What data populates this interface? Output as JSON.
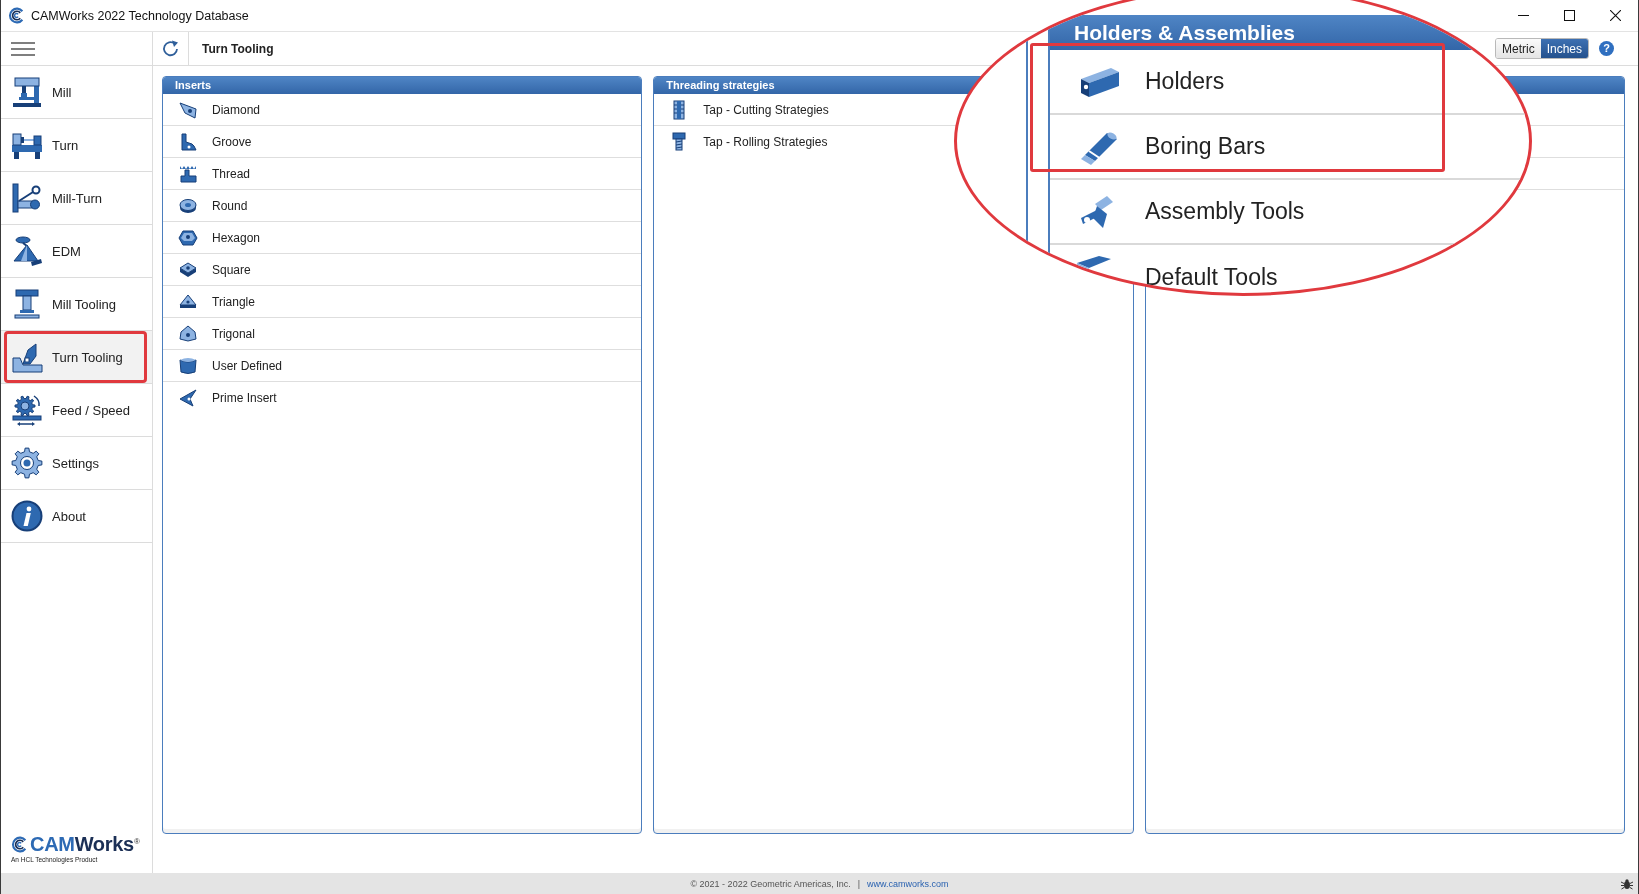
{
  "window": {
    "title": "CAMWorks 2022 Technology Database"
  },
  "toolbar": {
    "title": "Turn Tooling",
    "units": [
      {
        "label": "Metric",
        "selected": false
      },
      {
        "label": "Inches",
        "selected": true
      }
    ],
    "help": "?"
  },
  "sidebar": {
    "items": [
      {
        "label": "Mill",
        "selected": false,
        "highlighted": false
      },
      {
        "label": "Turn",
        "selected": false,
        "highlighted": false
      },
      {
        "label": "Mill-Turn",
        "selected": false,
        "highlighted": false
      },
      {
        "label": "EDM",
        "selected": false,
        "highlighted": false
      },
      {
        "label": "Mill Tooling",
        "selected": false,
        "highlighted": false
      },
      {
        "label": "Turn Tooling",
        "selected": true,
        "highlighted": true
      },
      {
        "label": "Feed / Speed",
        "selected": false,
        "highlighted": false
      },
      {
        "label": "Settings",
        "selected": false,
        "highlighted": false
      },
      {
        "label": "About",
        "selected": false,
        "highlighted": false
      }
    ]
  },
  "panels": [
    {
      "title": "Inserts",
      "items": [
        {
          "label": "Diamond"
        },
        {
          "label": "Groove"
        },
        {
          "label": "Thread"
        },
        {
          "label": "Round"
        },
        {
          "label": "Hexagon"
        },
        {
          "label": "Square"
        },
        {
          "label": "Triangle"
        },
        {
          "label": "Trigonal"
        },
        {
          "label": "User Defined"
        },
        {
          "label": "Prime Insert"
        }
      ]
    },
    {
      "title": "Threading strategies",
      "items": [
        {
          "label": "Tap - Cutting Strategies"
        },
        {
          "label": "Tap - Rolling Strategies"
        }
      ]
    }
  ],
  "magnifier": {
    "title": "Holders & Assemblies",
    "items": [
      {
        "label": "Holders",
        "highlighted": true
      },
      {
        "label": "Boring Bars",
        "highlighted": true
      },
      {
        "label": "Assembly Tools",
        "highlighted": false
      },
      {
        "label": "Default Tools",
        "highlighted": false
      }
    ]
  },
  "logo": {
    "wordmark": [
      "CAM",
      "Works"
    ],
    "mark": "®",
    "tagline": "An HCL Technologies Product"
  },
  "status_bar": {
    "copyright": "© 2021 - 2022 Geometric Americas, Inc.",
    "separator": "|",
    "link": "www.camworks.com"
  }
}
